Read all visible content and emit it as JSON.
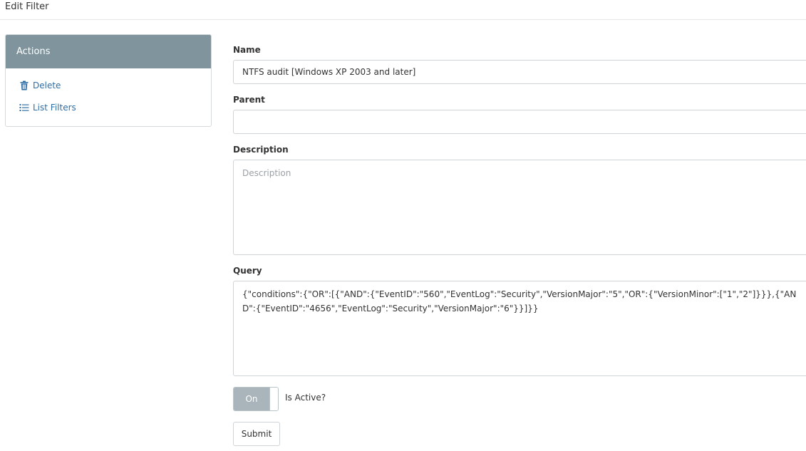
{
  "page": {
    "title": "Edit Filter"
  },
  "actions": {
    "header": "Actions",
    "items": [
      {
        "label": "Delete",
        "icon": "trash-icon"
      },
      {
        "label": "List Filters",
        "icon": "list-icon"
      }
    ]
  },
  "form": {
    "name": {
      "label": "Name",
      "value": "NTFS audit [Windows XP 2003 and later]"
    },
    "parent": {
      "label": "Parent",
      "value": ""
    },
    "description": {
      "label": "Description",
      "value": "",
      "placeholder": "Description"
    },
    "query": {
      "label": "Query",
      "value": "{\"conditions\":{\"OR\":[{\"AND\":{\"EventID\":\"560\",\"EventLog\":\"Security\",\"VersionMajor\":\"5\",\"OR\":{\"VersionMinor\":[\"1\",\"2\"]}}},{\"AND\":{\"EventID\":\"4656\",\"EventLog\":\"Security\",\"VersionMajor\":\"6\"}}]}}"
    },
    "active_toggle": {
      "state_label": "On",
      "label": "Is Active?",
      "checked": true
    },
    "submit_label": "Submit"
  },
  "colors": {
    "actions_header_bg": "#7f949c",
    "link": "#2f6ea5",
    "toggle_on_bg": "#a9b5bb"
  }
}
